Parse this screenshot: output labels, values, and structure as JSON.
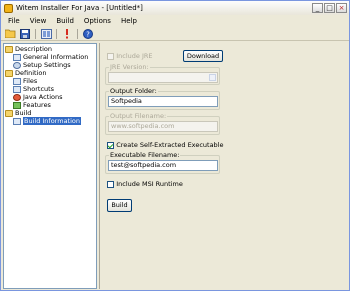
{
  "window": {
    "title": "Witem Installer For Java - [Untitled*]",
    "controls": [
      "_",
      "□",
      "×"
    ]
  },
  "menu": [
    "File",
    "View",
    "Build",
    "Options",
    "Help"
  ],
  "toolbar": {
    "buttons": [
      "open-icon",
      "save-icon",
      "build-icon",
      "run-icon",
      "help-icon"
    ]
  },
  "tree": {
    "items": [
      {
        "label": "Description",
        "level": 0,
        "icon": "folder-open-icon"
      },
      {
        "label": "General Information",
        "level": 1,
        "icon": "info-doc-icon"
      },
      {
        "label": "Setup Settings",
        "level": 1,
        "icon": "settings-icon"
      },
      {
        "label": "Definition",
        "level": 0,
        "icon": "folder-open-icon"
      },
      {
        "label": "Files",
        "level": 1,
        "icon": "files-icon"
      },
      {
        "label": "Shortcuts",
        "level": 1,
        "icon": "shortcut-icon"
      },
      {
        "label": "Java Actions",
        "level": 1,
        "icon": "java-icon"
      },
      {
        "label": "Features",
        "level": 1,
        "icon": "features-icon"
      },
      {
        "label": "Build",
        "level": 0,
        "icon": "folder-open-icon"
      },
      {
        "label": "Build Information",
        "level": 1,
        "icon": "build-info-icon",
        "selected": true
      }
    ]
  },
  "panel": {
    "include_jre_label": "Include JRE",
    "include_jre_checked": false,
    "download_label": "Download",
    "jre_version_title": "JRE Version:",
    "jre_version_value": "",
    "output_folder_title": "Output Folder:",
    "output_folder_value": "Softpedia",
    "output_filename_title": "Output Filename:",
    "output_filename_value": "www.softpedia.com",
    "self_extract_label": "Create Self-Extracted Executable",
    "self_extract_checked": true,
    "exe_filename_title": "Executable Filename:",
    "exe_filename_value": "test@softpedia.com",
    "msi_runtime_label": "Include MSI Runtime",
    "msi_runtime_checked": false,
    "build_label": "Build"
  }
}
